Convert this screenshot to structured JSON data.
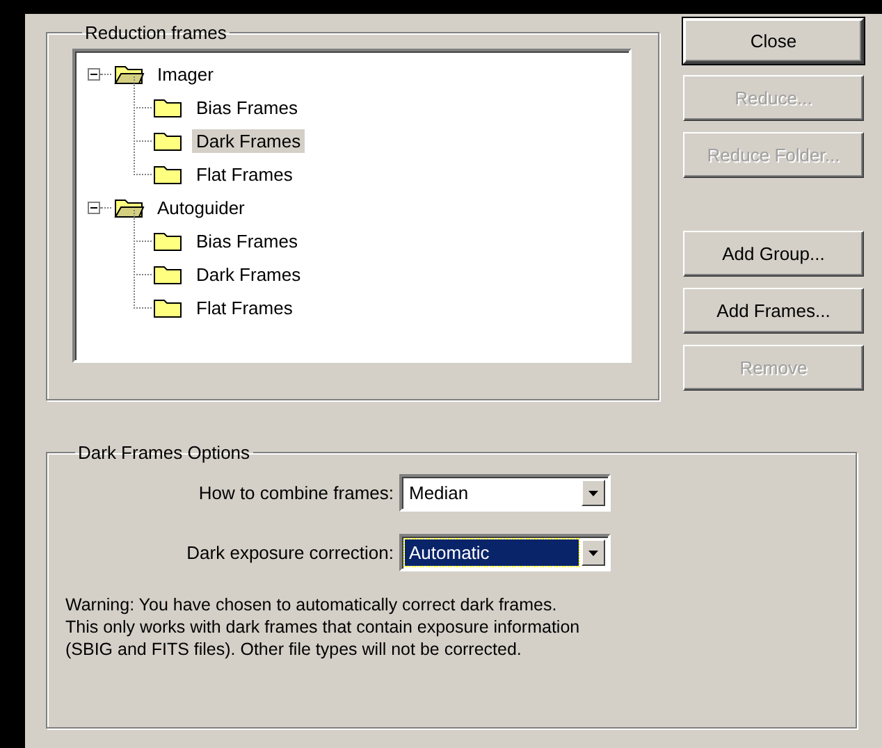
{
  "reduction_frames": {
    "title": "Reduction frames",
    "tree": [
      {
        "label": "Imager",
        "expanded": true,
        "selected": false,
        "children": [
          {
            "label": "Bias Frames",
            "selected": false
          },
          {
            "label": "Dark Frames",
            "selected": true
          },
          {
            "label": "Flat Frames",
            "selected": false
          }
        ]
      },
      {
        "label": "Autoguider",
        "expanded": true,
        "selected": false,
        "children": [
          {
            "label": "Bias Frames",
            "selected": false
          },
          {
            "label": "Dark Frames",
            "selected": false
          },
          {
            "label": "Flat Frames",
            "selected": false
          }
        ]
      }
    ]
  },
  "button_groups": [
    [
      {
        "label": "Close",
        "disabled": false,
        "default": true
      },
      {
        "label": "Reduce...",
        "disabled": true,
        "default": false
      },
      {
        "label": "Reduce Folder...",
        "disabled": true,
        "default": false
      }
    ],
    [
      {
        "label": "Add Group...",
        "disabled": false,
        "default": false
      },
      {
        "label": "Add Frames...",
        "disabled": false,
        "default": false
      },
      {
        "label": "Remove",
        "disabled": true,
        "default": false
      }
    ]
  ],
  "options": {
    "title": "Dark Frames Options",
    "fields": [
      {
        "label": "How to combine frames:",
        "value": "Median",
        "focused": false
      },
      {
        "label": "Dark exposure correction:",
        "value": "Automatic",
        "focused": true
      }
    ],
    "warning": "Warning: You have chosen to automatically correct dark frames.\nThis only works with dark frames that contain exposure information\n(SBIG and FITS files). Other file types will not be corrected."
  }
}
